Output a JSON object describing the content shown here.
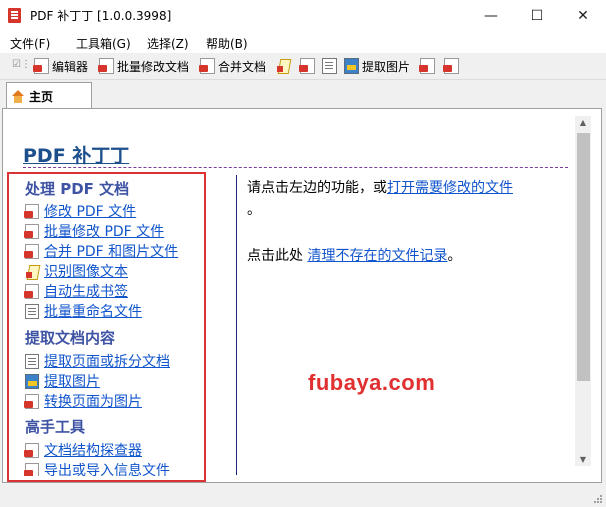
{
  "window": {
    "title": "PDF 补丁丁 [1.0.0.3998]",
    "minimize_glyph": "—",
    "maximize_glyph": "☐",
    "close_glyph": "✕"
  },
  "menu": [
    "文件(F)",
    "工具箱(G)",
    "选择(Z)",
    "帮助(B)"
  ],
  "toolbar": {
    "items": [
      {
        "label": "编辑器",
        "icon": "pdf-editor-icon"
      },
      {
        "label": "批量修改文档",
        "icon": "batch-modify-icon"
      },
      {
        "label": "合并文档",
        "icon": "merge-icon"
      },
      {
        "label": "",
        "icon": "ocr-icon"
      },
      {
        "label": "",
        "icon": "bookmark-icon"
      },
      {
        "label": "",
        "icon": "rename-icon"
      },
      {
        "label": "提取图片",
        "icon": "extract-image-icon"
      },
      {
        "label": "",
        "icon": "convert-icon"
      },
      {
        "label": "",
        "icon": "pdf-document-icon"
      }
    ]
  },
  "tab": {
    "label": "主页",
    "icon": "home-icon"
  },
  "main": {
    "title": "PDF 补丁丁",
    "sections": [
      {
        "heading": "处理 PDF 文档",
        "links": [
          {
            "label": "修改 PDF 文件",
            "icon": "pdf-icon"
          },
          {
            "label": "批量修改 PDF 文件",
            "icon": "batch-pdf-icon"
          },
          {
            "label": "合并 PDF 和图片文件",
            "icon": "merge-icon"
          },
          {
            "label": "识别图像文本",
            "icon": "ocr-icon"
          },
          {
            "label": "自动生成书签",
            "icon": "bookmark-icon"
          },
          {
            "label": "批量重命名文件",
            "icon": "rename-icon"
          }
        ]
      },
      {
        "heading": "提取文档内容",
        "links": [
          {
            "label": "提取页面或拆分文档",
            "icon": "split-icon"
          },
          {
            "label": "提取图片",
            "icon": "image-icon"
          },
          {
            "label": "转换页面为图片",
            "icon": "convert-icon"
          }
        ]
      },
      {
        "heading": "高手工具",
        "links": [
          {
            "label": "文档结构探查器",
            "icon": "inspector-icon"
          },
          {
            "label": "导出或导入信息文件",
            "icon": "export-icon"
          }
        ]
      }
    ],
    "right": {
      "line1_prefix": "请点击左边的功能，或",
      "line1_link": "打开需要修改的文件",
      "line1_suffix": "。",
      "line2_prefix": "点击此处 ",
      "line2_link": "清理不存在的文件记录",
      "line2_suffix": "。"
    }
  },
  "watermark": "fubaya.com",
  "colors": {
    "link": "#1155cc",
    "section_heading": "#3e53a3",
    "title": "#1c4f8c",
    "highlight_box": "#dc3232",
    "watermark": "#e03030"
  }
}
